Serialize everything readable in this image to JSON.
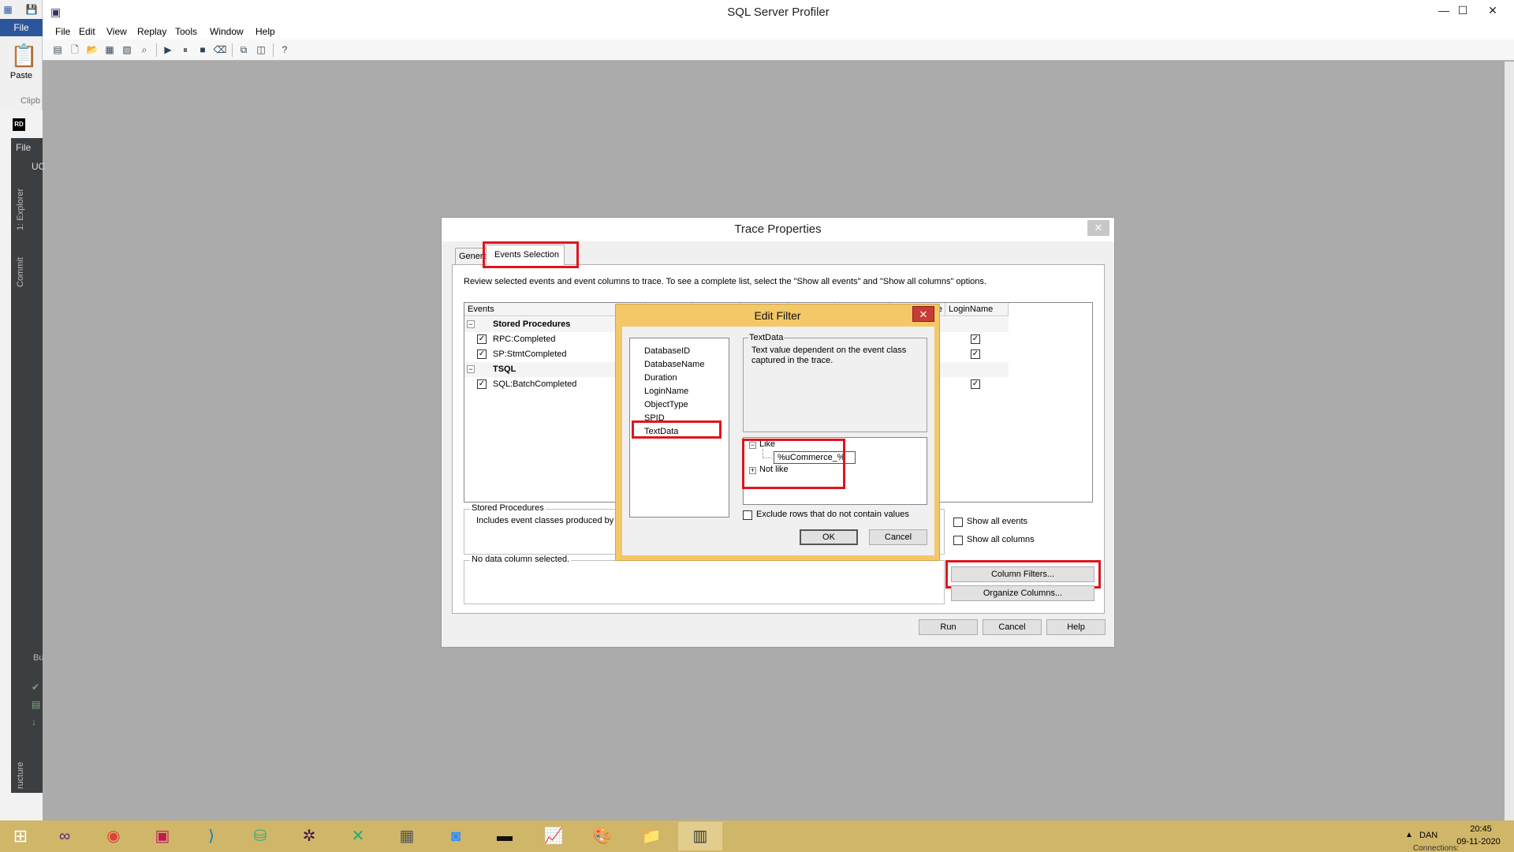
{
  "app": {
    "title": "SQL Server Profiler",
    "menu": [
      "File",
      "Edit",
      "View",
      "Replay",
      "Tools",
      "Window",
      "Help"
    ]
  },
  "background": {
    "file_tab": "File",
    "paste_label": "Paste",
    "clipboard_label": "Clipb",
    "rider_logo": "RD",
    "rider_file": "File",
    "rider_uc": "UC",
    "explorer_label": "1: Explorer",
    "commit_label": "Commit",
    "bu_label": "Bu",
    "structure_label": "ructure"
  },
  "trace_dialog": {
    "title": "Trace Properties",
    "tabs": {
      "general": "General",
      "events": "Events Selection"
    },
    "instruction": "Review selected events and event columns to trace. To see a complete list, select the \"Show all events\" and \"Show all columns\" options.",
    "grid": {
      "events_header": "Events",
      "partial_header": "e",
      "loginname_header": "LoginName",
      "rows": [
        {
          "label": "Stored Procedures",
          "category": true
        },
        {
          "label": "RPC:Completed",
          "checked": true,
          "login": true
        },
        {
          "label": "SP:StmtCompleted",
          "checked": true,
          "login": true
        },
        {
          "label": "TSQL",
          "category": true
        },
        {
          "label": "SQL:BatchCompleted",
          "checked": true,
          "login": true
        }
      ]
    },
    "group_title": "Stored Procedures",
    "group_desc": "Includes event classes produced by the execution of stored procedures.",
    "no_data": "No data column selected.",
    "show_all_events": "Show all events",
    "show_all_columns": "Show all columns",
    "column_filters": "Column Filters...",
    "organize_columns": "Organize Columns...",
    "run": "Run",
    "cancel": "Cancel",
    "help": "Help"
  },
  "filter_dialog": {
    "title": "Edit Filter",
    "columns": [
      "DatabaseID",
      "DatabaseName",
      "Duration",
      "LoginName",
      "ObjectType",
      "SPID",
      "TextData"
    ],
    "selected_column": "TextData",
    "desc_title": "TextData",
    "desc_text": "Text value dependent on the event class captured in the trace.",
    "like_label": "Like",
    "like_value": "%uCommerce_%",
    "not_like_label": "Not like",
    "exclude_label": "Exclude rows that do not contain values",
    "ok": "OK",
    "cancel": "Cancel"
  },
  "taskbar": {
    "lang": "DAN",
    "time": "20:45",
    "date": "09-11-2020",
    "connections": "Connections:"
  },
  "colors": {
    "highlight_red": "#e0141c",
    "taskbar": "#d0b668",
    "filter_frame": "#f4c767"
  }
}
